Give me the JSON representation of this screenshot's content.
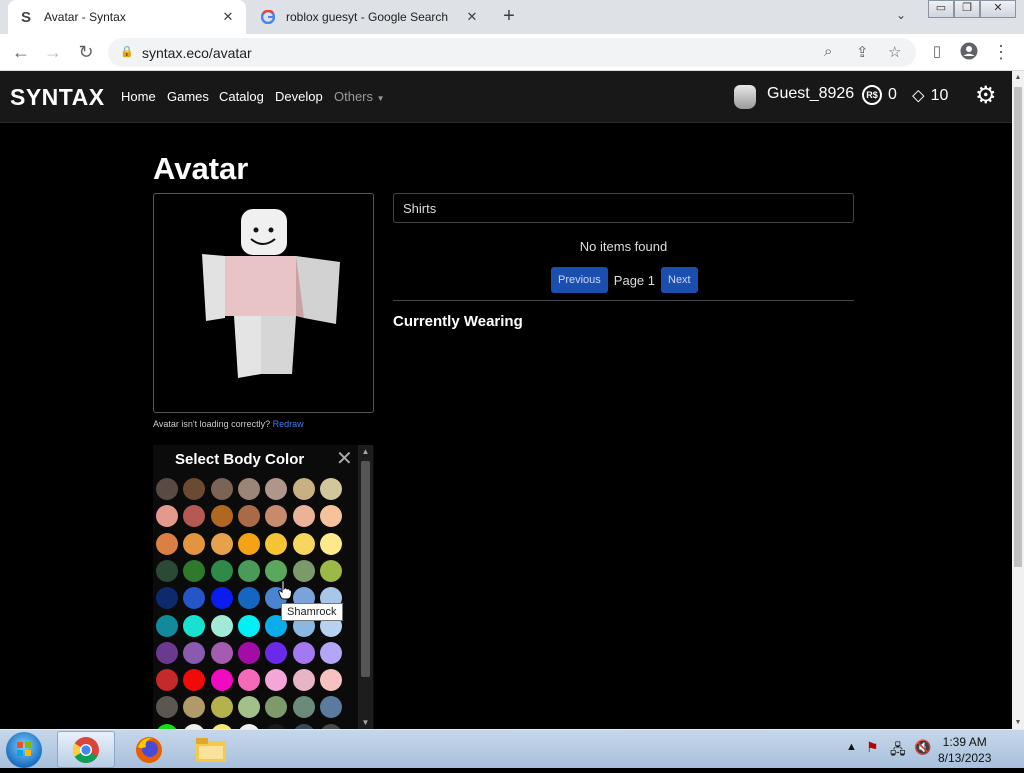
{
  "browser": {
    "tabs": [
      {
        "title": "Avatar - Syntax",
        "favicon": "syntax-s-icon",
        "active": true
      },
      {
        "title": "roblox guesyt - Google Search",
        "favicon": "google-icon",
        "active": false
      }
    ],
    "url": "syntax.eco/avatar"
  },
  "site": {
    "logo": "SYNTAX",
    "nav": [
      "Home",
      "Games",
      "Catalog",
      "Develop",
      "Others"
    ],
    "username": "Guest_8926",
    "robux": "0",
    "tickets": "10"
  },
  "page": {
    "title": "Avatar",
    "hint_text": "Avatar isn't loading correctly?",
    "redraw_label": "Redraw",
    "search_value": "Shirts",
    "no_items": "No items found",
    "prev_label": "Previous",
    "page_label": "Page 1",
    "next_label": "Next",
    "currently_wearing": "Currently Wearing"
  },
  "color_panel": {
    "title": "Select Body Color",
    "tooltip": "Shamrock",
    "rows": [
      [
        "#5a4a44",
        "#6b4a32",
        "#7b6456",
        "#9c8478",
        "#b0968a",
        "#c9b082",
        "#d2c69c"
      ],
      [
        "#e39a8c",
        "#b55a52",
        "#b06820",
        "#a96a48",
        "#c78a6c",
        "#eab298",
        "#f5c29c"
      ],
      [
        "#da8044",
        "#e2943e",
        "#e6a24a",
        "#f5a316",
        "#f5c434",
        "#f6d55e",
        "#fde98c"
      ],
      [
        "#2a4a36",
        "#2e7a2a",
        "#2e8a46",
        "#4a9a5a",
        "#5aa85e",
        "#7a9a6a",
        "#9cb846"
      ],
      [
        "#0e2a6c",
        "#2456c8",
        "#0a1cf0",
        "#1466c0",
        "#4a84d0",
        "#7ca2dc",
        "#a8c6ea"
      ],
      [
        "#128a9c",
        "#1ae0d2",
        "#a2ead8",
        "#00f0f6",
        "#0aacea",
        "#8ab8e0",
        "#b6d2f0"
      ],
      [
        "#6a3a90",
        "#8a5aae",
        "#a45cb0",
        "#a40ca8",
        "#6a2ae8",
        "#a478f0",
        "#b4a6f6"
      ],
      [
        "#c42a2a",
        "#f00a0a",
        "#f00ac0",
        "#f46ab8",
        "#f4a6d6",
        "#e6b4c4",
        "#f6c2c0"
      ],
      [
        "#5c5650",
        "#b09a6a",
        "#b4b24a",
        "#a2c08a",
        "#7c9a6a",
        "#6a8a7a",
        "#5a7aa0"
      ],
      [
        "#12e012",
        "#f0f0e8",
        "#f6e672",
        "#f0f0f0",
        "#1a1a1a",
        "#3a4a5a",
        "#4a4a4a"
      ]
    ]
  }
}
